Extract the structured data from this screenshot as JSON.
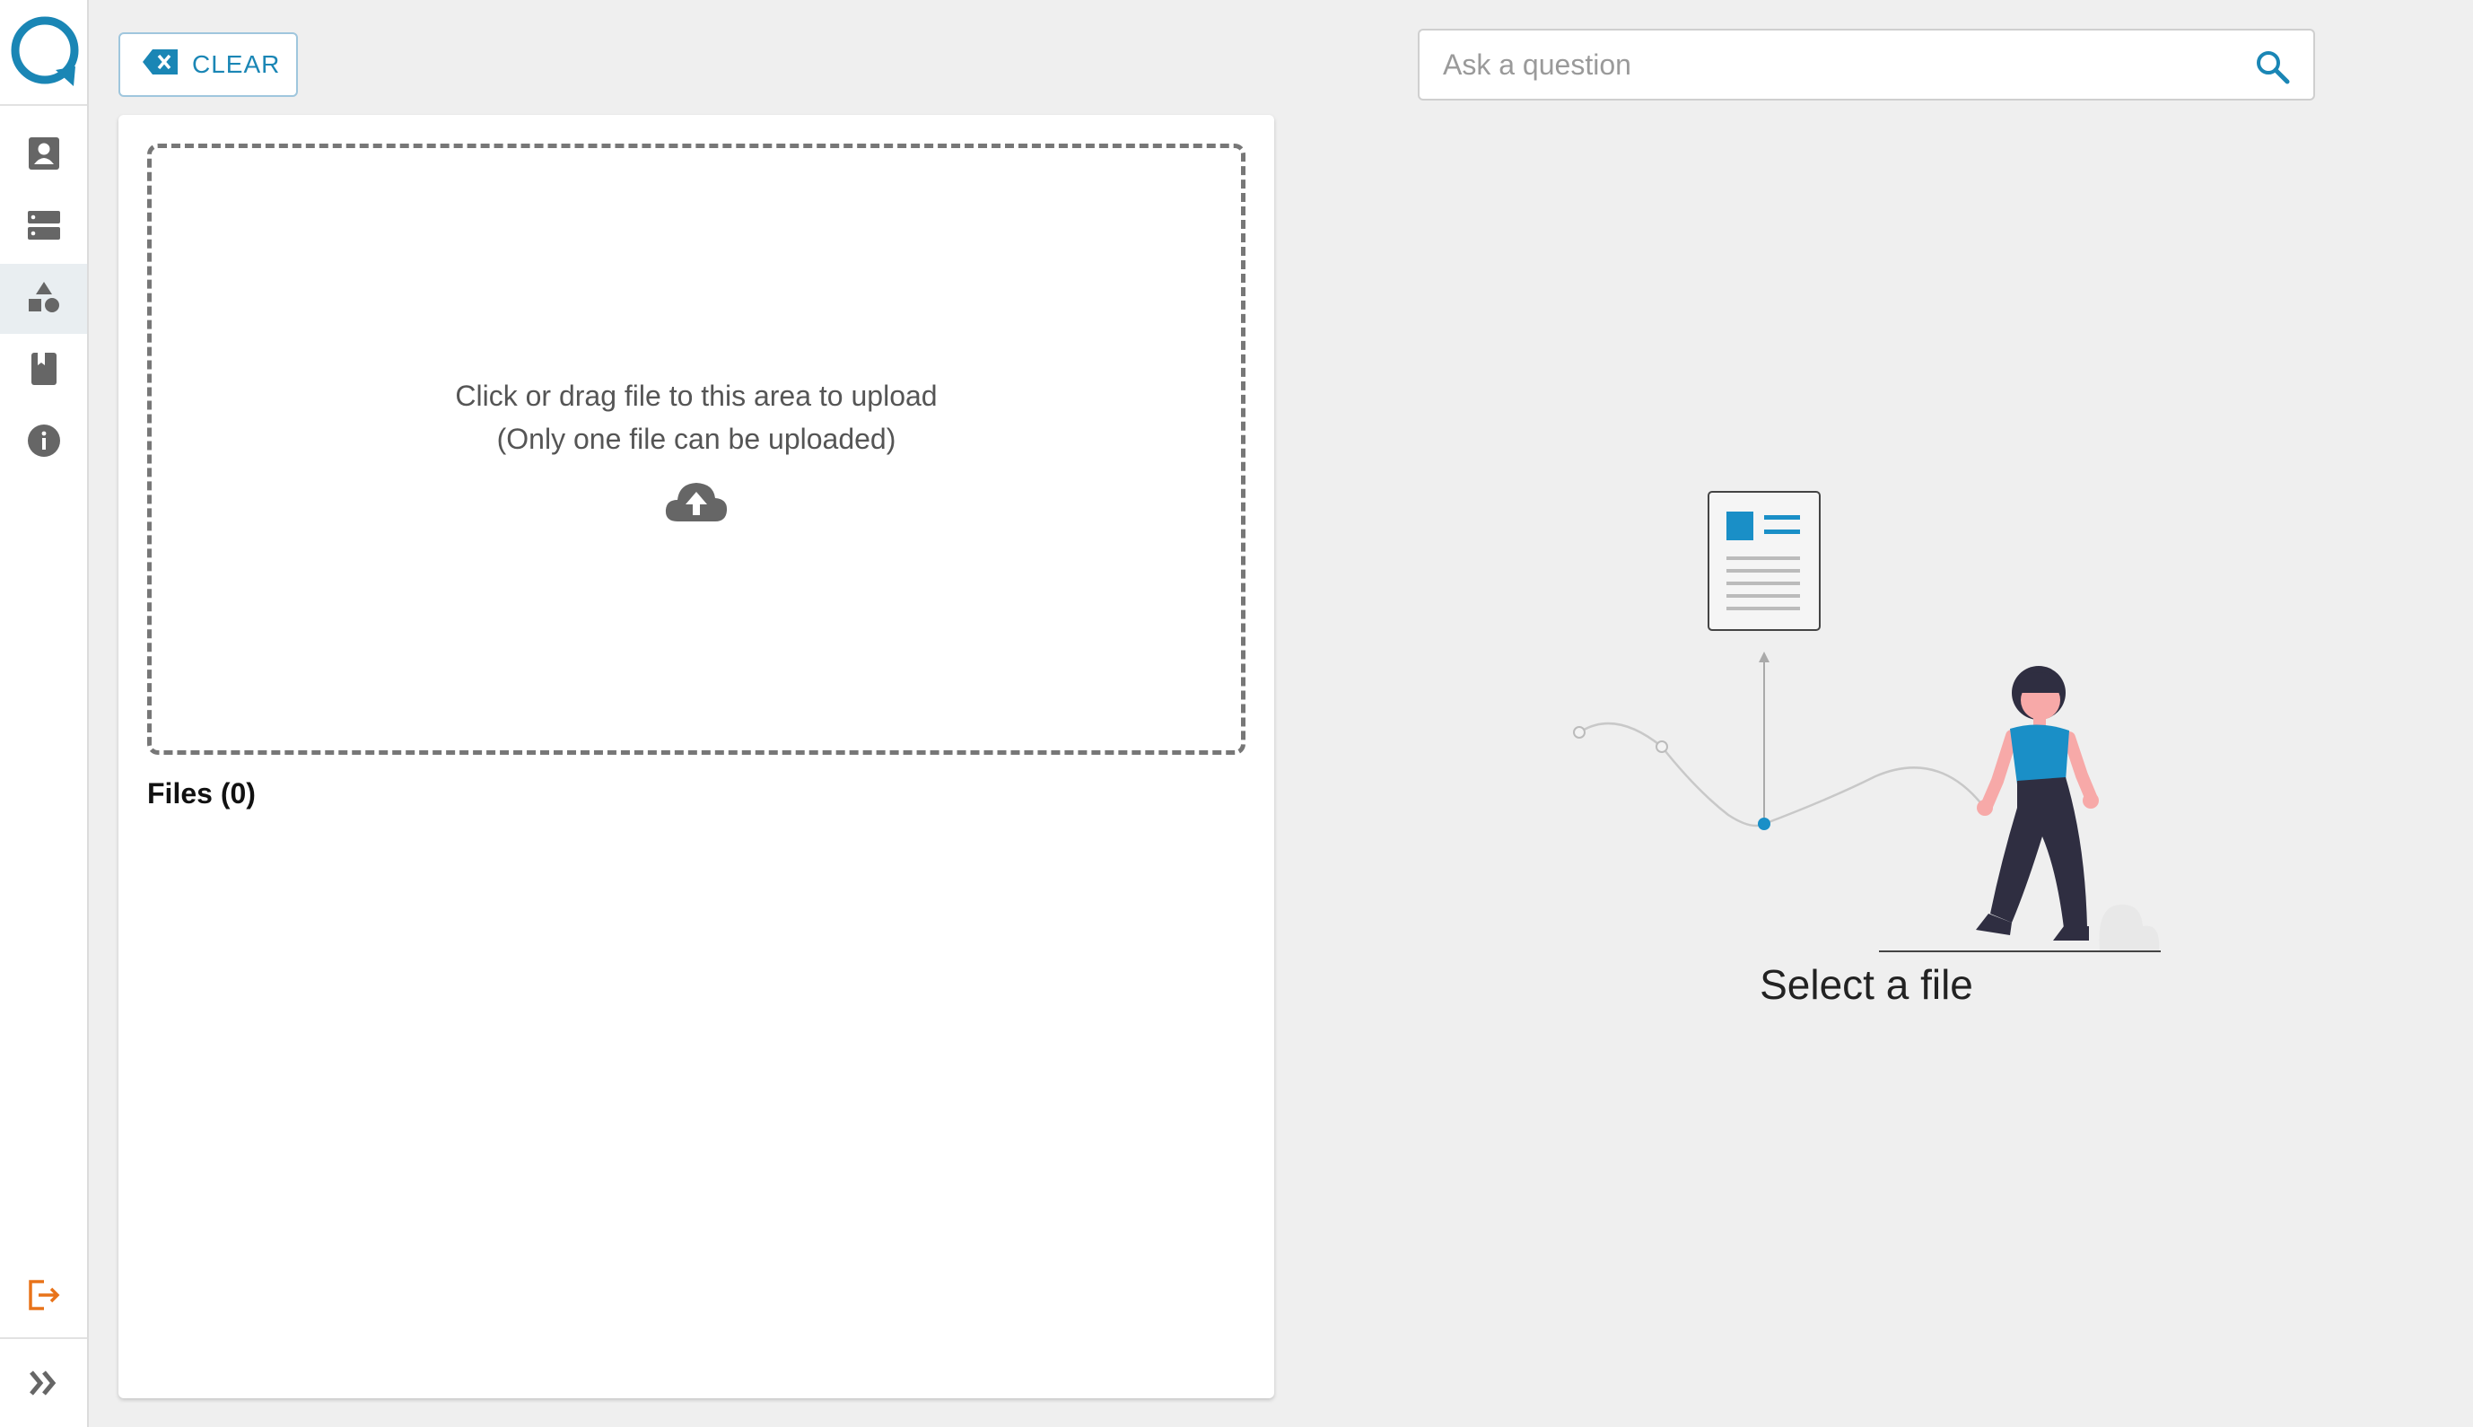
{
  "toolbar": {
    "clear_label": "CLEAR"
  },
  "sidebar": {
    "items": [
      {
        "icon": "user-badge-icon"
      },
      {
        "icon": "server-icon"
      },
      {
        "icon": "shapes-icon",
        "active": true
      },
      {
        "icon": "bookmark-book-icon"
      },
      {
        "icon": "info-icon"
      }
    ],
    "logout_icon": "logout-icon",
    "expand_icon": "expand-double-chevron-icon"
  },
  "upload": {
    "line1": "Click or drag file to this area to upload",
    "line2": "(Only one file can be uploaded)",
    "icon": "cloud-upload-icon"
  },
  "files": {
    "title": "Files (0)"
  },
  "search": {
    "placeholder": "Ask a question"
  },
  "empty_state": {
    "message": "Select a file"
  },
  "colors": {
    "accent": "#1a86b5",
    "logout": "#e8731a",
    "illustration_blue": "#1a8fc7",
    "illustration_dark": "#2f2e41",
    "skin": "#f7a9a8"
  }
}
